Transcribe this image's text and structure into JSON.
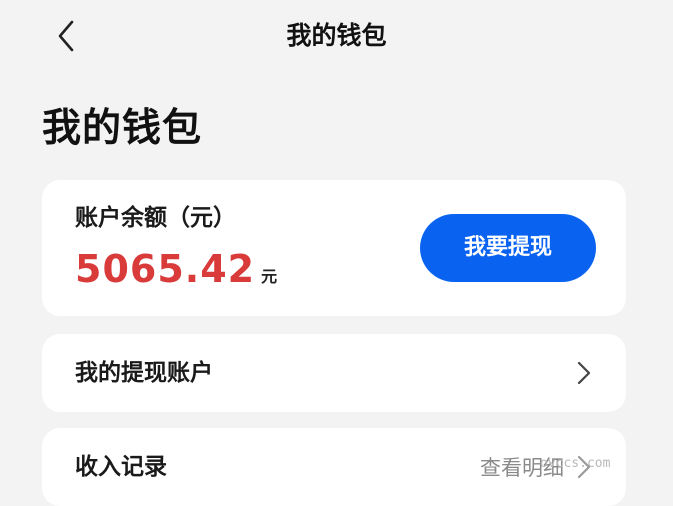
{
  "nav": {
    "back_icon": "chevron-left-icon",
    "title": "我的钱包"
  },
  "page": {
    "title": "我的钱包"
  },
  "balance": {
    "label": "账户余额（元）",
    "amount": "5065.42",
    "unit": "元",
    "amount_color": "#d93a3a"
  },
  "actions": {
    "withdraw_label": "我要提现",
    "accent_color": "#0a63f0"
  },
  "list": {
    "items": [
      {
        "label": "我的提现账户",
        "hint": "",
        "icon": "chevron-right-icon"
      },
      {
        "label": "收入记录",
        "hint": "查看明细",
        "icon": "chevron-right-icon"
      }
    ]
  },
  "watermark": {
    "text": "ovccs.com"
  }
}
